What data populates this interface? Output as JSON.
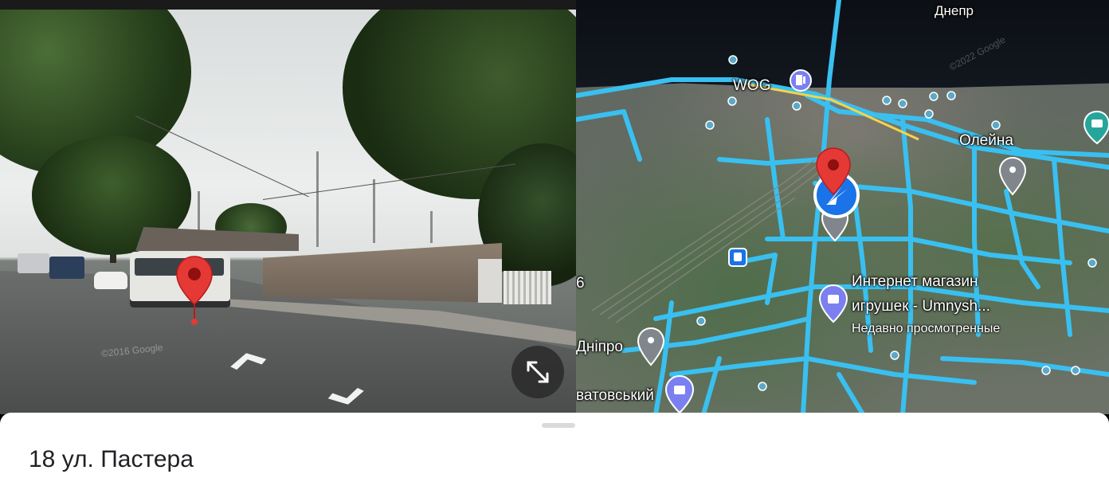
{
  "street_view": {
    "watermark": "©2016 Google",
    "expand_icon": "expand-arrows-icon",
    "pin_icon": "red-map-pin-icon"
  },
  "map": {
    "watermark": "©2022 Google",
    "labels": {
      "dnepr": "Днепр",
      "wog": "WOG",
      "oleina": "Олейна",
      "toy_store_line1": "Интернет магазин",
      "toy_store_line2": "игрушек - Umnysh...",
      "toy_store_sub": "Недавно просмотренные",
      "dnipro": "Дніпро",
      "district": "ватовський",
      "edge_digit": "6"
    },
    "colors": {
      "streets": "#39c0f0",
      "pin": "#e53935",
      "location": "#1a73e8",
      "poi": "#7b7ff0"
    }
  },
  "sheet": {
    "address": "18 ул. Пастера"
  }
}
